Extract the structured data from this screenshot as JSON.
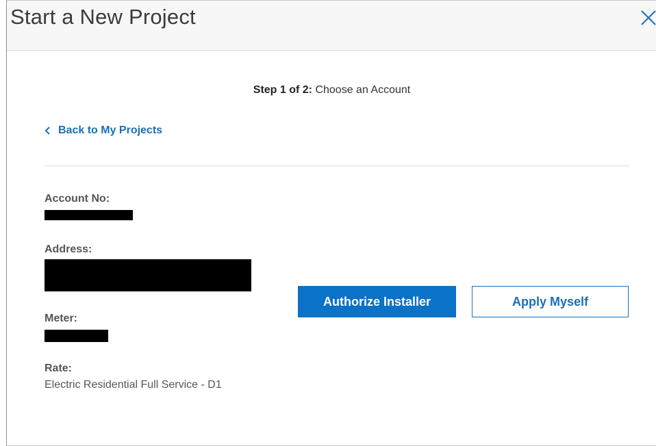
{
  "modal": {
    "title": "Start a New Project",
    "close_icon": "close-icon"
  },
  "step": {
    "prefix": "Step 1 of 2:",
    "text": "Choose an Account"
  },
  "back_link": {
    "label": "Back to My Projects",
    "icon": "chevron-left-icon"
  },
  "account": {
    "account_no_label": "Account No:",
    "address_label": "Address:",
    "meter_label": "Meter:",
    "rate_label": "Rate:",
    "rate_value": "Electric Residential Full Service - D1"
  },
  "actions": {
    "authorize_label": "Authorize Installer",
    "apply_label": "Apply Myself"
  },
  "colors": {
    "primary": "#0a72c7",
    "link": "#1a6fb5"
  }
}
